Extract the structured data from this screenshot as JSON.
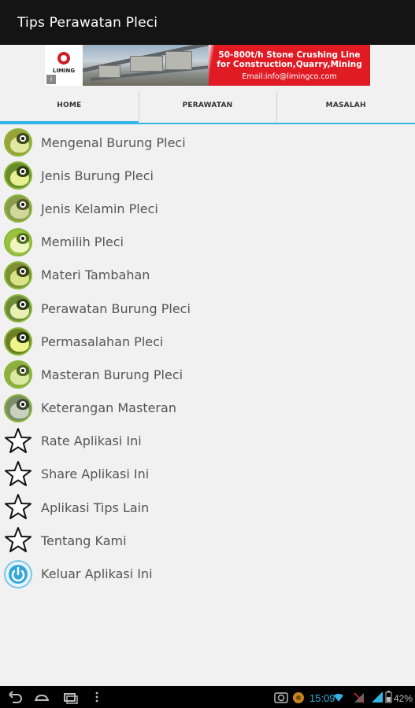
{
  "app": {
    "title": "Tips Perawatan Pleci"
  },
  "ad": {
    "brand": "LIMING",
    "line1": "50-800t/h Stone Crushing Line",
    "line2": "for Construction,Quarry,Mining",
    "line3": "Email:info@limingco.com",
    "accent_color": "#e01b24"
  },
  "tabs": [
    {
      "label": "HOME",
      "active": true
    },
    {
      "label": "PERAWATAN",
      "active": false
    },
    {
      "label": "MASALAH",
      "active": false
    }
  ],
  "accent_color": "#33b5e5",
  "menu": [
    {
      "label": "Mengenal Burung Pleci",
      "icon": "bird-icon"
    },
    {
      "label": "Jenis Burung Pleci",
      "icon": "bird-icon"
    },
    {
      "label": "Jenis Kelamin Pleci",
      "icon": "bird-icon"
    },
    {
      "label": "Memilih Pleci",
      "icon": "bird-icon"
    },
    {
      "label": "Materi Tambahan",
      "icon": "bird-icon"
    },
    {
      "label": "Perawatan Burung Pleci",
      "icon": "bird-icon"
    },
    {
      "label": "Permasalahan Pleci",
      "icon": "bird-icon"
    },
    {
      "label": "Masteran Burung Pleci",
      "icon": "bird-icon"
    },
    {
      "label": "Keterangan Masteran",
      "icon": "bird-icon"
    },
    {
      "label": "Rate Aplikasi Ini",
      "icon": "star-icon"
    },
    {
      "label": "Share Aplikasi Ini",
      "icon": "star-icon"
    },
    {
      "label": "Aplikasi Tips Lain",
      "icon": "star-icon"
    },
    {
      "label": "Tentang Kami",
      "icon": "star-icon"
    },
    {
      "label": "Keluar Aplikasi Ini",
      "icon": "power-icon"
    }
  ],
  "statusbar": {
    "time": "15:09",
    "battery": "42%"
  }
}
